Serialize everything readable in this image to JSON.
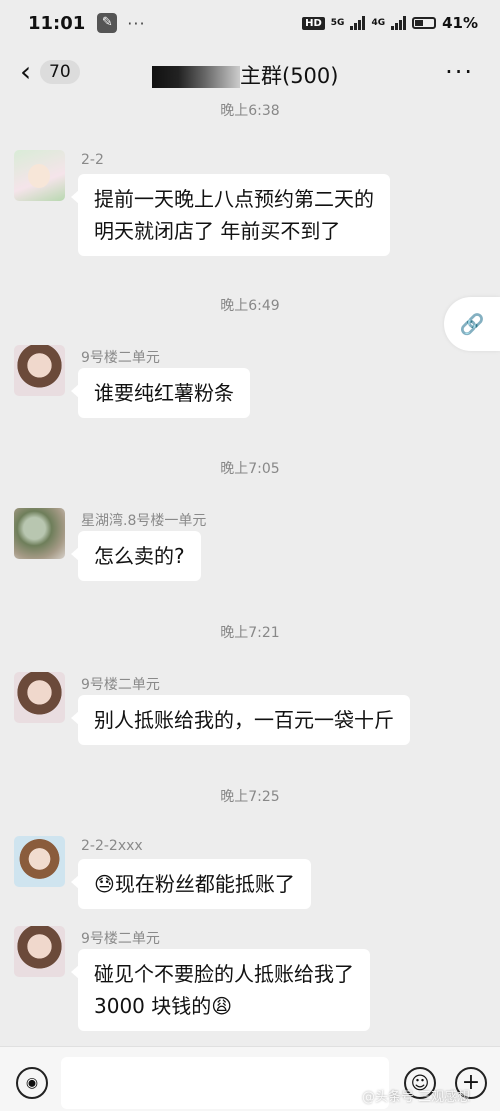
{
  "status_bar": {
    "time": "11:01",
    "dots": "···",
    "hd": "HD",
    "net1": "5G",
    "net2": "4G",
    "battery": "41%"
  },
  "header": {
    "back_icon": "chevron-left-icon",
    "unread_count": "70",
    "title": "主群(500)",
    "more_label": "···"
  },
  "chat": {
    "messages": [
      {
        "time": "晚上6:38",
        "sender": "2-2",
        "text": "提前一天晚上八点预约第二天的\n明天就闭店了 年前买不到了",
        "avatar": "landscape-girl"
      },
      {
        "time": "晚上6:49",
        "sender": "9号楼二单元",
        "text": "谁要纯红薯粉条",
        "avatar": "girl"
      },
      {
        "time": "晚上7:05",
        "sender": "星湖湾.8号楼一单元",
        "text": "怎么卖的?",
        "avatar": "flowers"
      },
      {
        "time": "晚上7:21",
        "sender": "9号楼二单元",
        "text": "别人抵账给我的，一百元一袋十斤",
        "avatar": "girl"
      },
      {
        "time": "晚上7:25",
        "sender": "2-2-2xxx",
        "text": "😓现在粉丝都能抵账了",
        "avatar": "boy"
      },
      {
        "time": "",
        "sender": "9号楼二单元",
        "text": "碰见个不要脸的人抵账给我了\n3000 块钱的😩",
        "avatar": "girl"
      }
    ]
  },
  "link_button": {
    "icon": "link-icon"
  },
  "input_bar": {
    "voice_icon": "voice-icon",
    "emoji_icon": "emoji-icon",
    "plus_icon": "plus-icon",
    "watermark": "@头条号 三观感想"
  }
}
